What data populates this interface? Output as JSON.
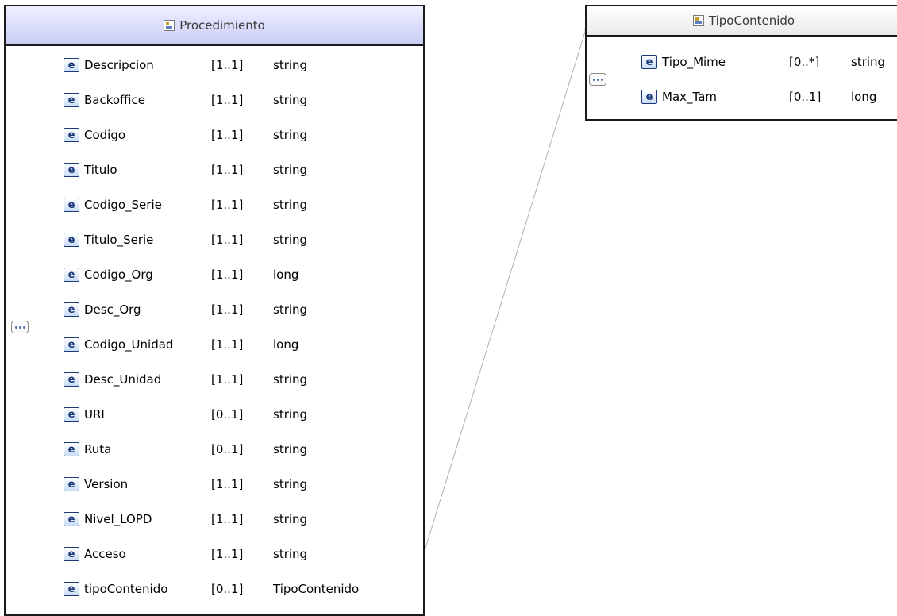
{
  "procedimiento": {
    "title": "Procedimiento",
    "elements": [
      {
        "name": "Descripcion",
        "card": "[1..1]",
        "type": "string"
      },
      {
        "name": "Backoffice",
        "card": "[1..1]",
        "type": "string"
      },
      {
        "name": "Codigo",
        "card": "[1..1]",
        "type": "string"
      },
      {
        "name": "Titulo",
        "card": "[1..1]",
        "type": "string"
      },
      {
        "name": "Codigo_Serie",
        "card": "[1..1]",
        "type": "string"
      },
      {
        "name": "Titulo_Serie",
        "card": "[1..1]",
        "type": "string"
      },
      {
        "name": "Codigo_Org",
        "card": "[1..1]",
        "type": "long"
      },
      {
        "name": "Desc_Org",
        "card": "[1..1]",
        "type": "string"
      },
      {
        "name": "Codigo_Unidad",
        "card": "[1..1]",
        "type": "long"
      },
      {
        "name": "Desc_Unidad",
        "card": "[1..1]",
        "type": "string"
      },
      {
        "name": "URI",
        "card": "[0..1]",
        "type": "string"
      },
      {
        "name": "Ruta",
        "card": "[0..1]",
        "type": "string"
      },
      {
        "name": "Version",
        "card": "[1..1]",
        "type": "string"
      },
      {
        "name": "Nivel_LOPD",
        "card": "[1..1]",
        "type": "string"
      },
      {
        "name": "Acceso",
        "card": "[1..1]",
        "type": "string"
      },
      {
        "name": "tipoContenido",
        "card": "[0..1]",
        "type": "TipoContenido"
      }
    ]
  },
  "tipoContenido": {
    "title": "TipoContenido",
    "elements": [
      {
        "name": "Tipo_Mime",
        "card": "[0..*]",
        "type": "string"
      },
      {
        "name": "Max_Tam",
        "card": "[0..1]",
        "type": "long"
      }
    ]
  },
  "badge_letter": "e",
  "colors": {
    "header_procedimiento": "#c9cdf6",
    "header_tipo": "#eaeaea",
    "badge_border": "#1c3a7a",
    "connector": "#b0b0b0"
  }
}
